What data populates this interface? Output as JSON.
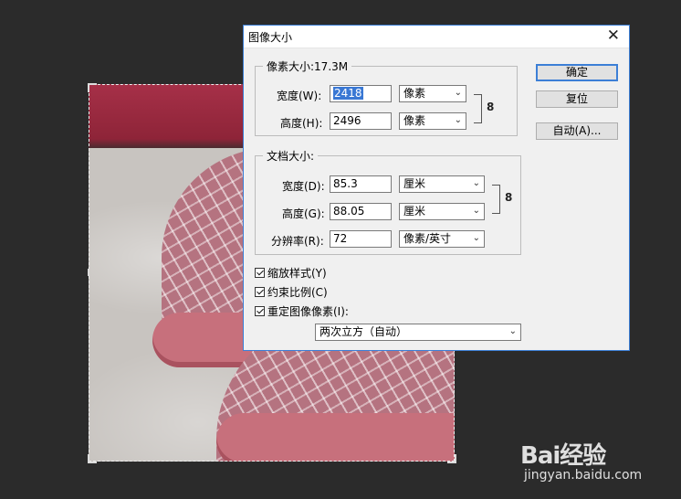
{
  "dialog": {
    "title": "图像大小",
    "close_glyph": "✕",
    "pixel_dimensions": {
      "legend": "像素大小:17.3M",
      "width_label": "宽度(W):",
      "width_value": "2418",
      "width_unit": "像素",
      "height_label": "高度(H):",
      "height_value": "2496",
      "height_unit": "像素"
    },
    "document_size": {
      "legend": "文档大小:",
      "width_label": "宽度(D):",
      "width_value": "85.3",
      "width_unit": "厘米",
      "height_label": "高度(G):",
      "height_value": "88.05",
      "height_unit": "厘米",
      "resolution_label": "分辨率(R):",
      "resolution_value": "72",
      "resolution_unit": "像素/英寸"
    },
    "buttons": {
      "ok": "确定",
      "reset": "复位",
      "auto": "自动(A)..."
    },
    "options": {
      "scale_styles": "缩放样式(Y)",
      "constrain_proportions": "约束比例(C)",
      "resample_image": "重定图像像素(I):",
      "resample_method": "两次立方（自动）"
    },
    "link_glyph": "8"
  },
  "watermark": {
    "logo": "Bai经验",
    "paw": "🐾",
    "url": "jingyan.baidu.com"
  },
  "colors": {
    "accent": "#3c7fd6",
    "dialog_bg": "#f0f0f0",
    "canvas_bg": "#2b2b2b"
  }
}
